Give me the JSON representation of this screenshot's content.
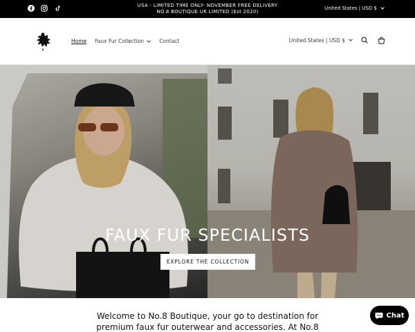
{
  "announcement": {
    "line1": "USA - LIMITED TIME ONLY- NOVEMBER FREE DELIVERY",
    "line2": "NO.8 BOUTIQUE UK LIMITED (Est 2020)",
    "currency": "United States | USD $",
    "social_icons": [
      "facebook-icon",
      "instagram-icon",
      "tiktok-icon"
    ]
  },
  "header": {
    "nav": {
      "home": "Home",
      "faux_fur": "Faux Fur Collection",
      "contact": "Contact"
    },
    "currency": "United States | USD $",
    "icons": [
      "search-icon",
      "cart-icon"
    ]
  },
  "hero": {
    "title": "FAUX FUR SPECIALISTS",
    "button": "EXPLORE THE COLLECTION"
  },
  "welcome": {
    "line1": "Welcome to No.8 Boutique, your go to destination for",
    "line2": "premium faux fur outerwear and accessories. At No.8"
  },
  "chat": {
    "label": "Chat"
  },
  "colors": {
    "announcement_bg": "#000000",
    "accent_text": "#121212"
  }
}
